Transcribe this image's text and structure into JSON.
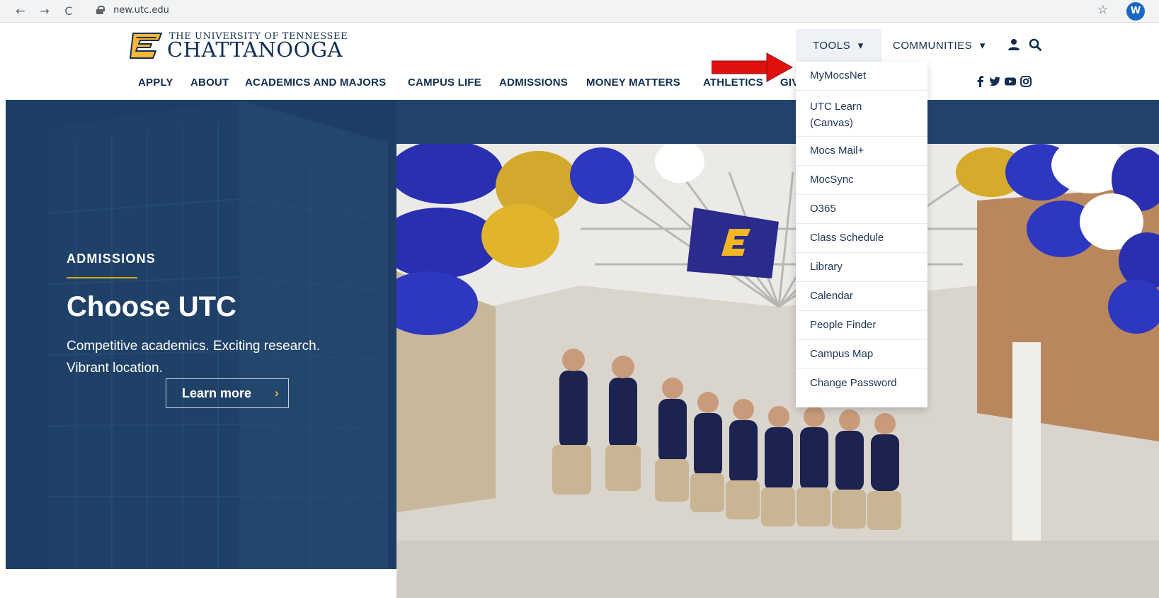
{
  "browser": {
    "url": "new.utc.edu",
    "back_label": "←",
    "forward_label": "→",
    "reload_label": "C",
    "profile_initial": "W"
  },
  "site": {
    "logo_line1": "THE UNIVERSITY OF TENNESSEE",
    "logo_line2": "CHATTANOOGA",
    "utility_nav": {
      "tools_label": "TOOLS",
      "communities_label": "COMMUNITIES"
    },
    "main_nav": [
      "APPLY",
      "ABOUT",
      "ACADEMICS AND MAJORS",
      "CAMPUS LIFE",
      "ADMISSIONS",
      "MONEY MATTERS",
      "ATHLETICS",
      "GIVING"
    ],
    "social_icons": [
      "facebook-icon",
      "twitter-icon",
      "youtube-icon",
      "instagram-icon"
    ]
  },
  "hero": {
    "eyebrow": "ADMISSIONS",
    "title": "Choose UTC",
    "text": "Competitive academics. Exciting research. Vibrant location.",
    "cta_label": "Learn more"
  },
  "tools_menu": {
    "items": [
      "MyMocsNet",
      "UTC Learn (Canvas)",
      "Mocs Mail+",
      "MocSync",
      "O365",
      "Class Schedule",
      "Library",
      "Calendar",
      "People Finder",
      "Campus Map",
      "Change Password"
    ]
  },
  "colors": {
    "navy": "#112e51",
    "gold": "#e0aa0f",
    "hero_blue": "#1f4068",
    "annotation_red": "#e31010"
  }
}
